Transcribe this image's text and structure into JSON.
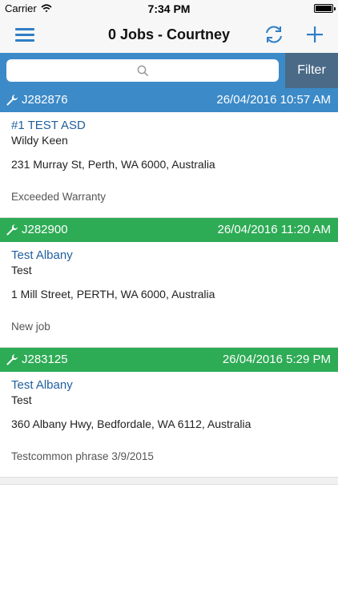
{
  "status": {
    "carrier": "Carrier",
    "time": "7:34 PM"
  },
  "nav": {
    "title": "0 Jobs - Courtney"
  },
  "search": {
    "placeholder": "",
    "filter_label": "Filter"
  },
  "colors": {
    "accent": "#3c8ac8",
    "job_blue": "#3c8ac8",
    "job_green": "#2eab55",
    "filter_bg": "#4a6a87"
  },
  "jobs": [
    {
      "id": "J282876",
      "date": "26/04/2016 10:57 AM",
      "title": "#1 TEST ASD",
      "customer": "Wildy Keen",
      "address": "231 Murray St, Perth, WA 6000, Australia",
      "note": "Exceeded Warranty",
      "color": "#3c8ac8"
    },
    {
      "id": "J282900",
      "date": "26/04/2016 11:20 AM",
      "title": "Test Albany",
      "customer": "Test",
      "address": "1 Mill Street, PERTH, WA 6000, Australia",
      "note": "New job",
      "color": "#2eab55"
    },
    {
      "id": "J283125",
      "date": "26/04/2016 5:29 PM",
      "title": "Test Albany",
      "customer": "Test",
      "address": "360 Albany Hwy, Bedfordale, WA 6112, Australia",
      "note": "Testcommon phrase 3/9/2015",
      "color": "#2eab55"
    }
  ],
  "icons": {
    "wifi": "wifi-icon",
    "battery": "battery-icon",
    "menu": "hamburger-menu-icon",
    "refresh": "refresh-icon",
    "add": "plus-icon",
    "search": "search-icon",
    "wrench": "wrench-icon"
  }
}
